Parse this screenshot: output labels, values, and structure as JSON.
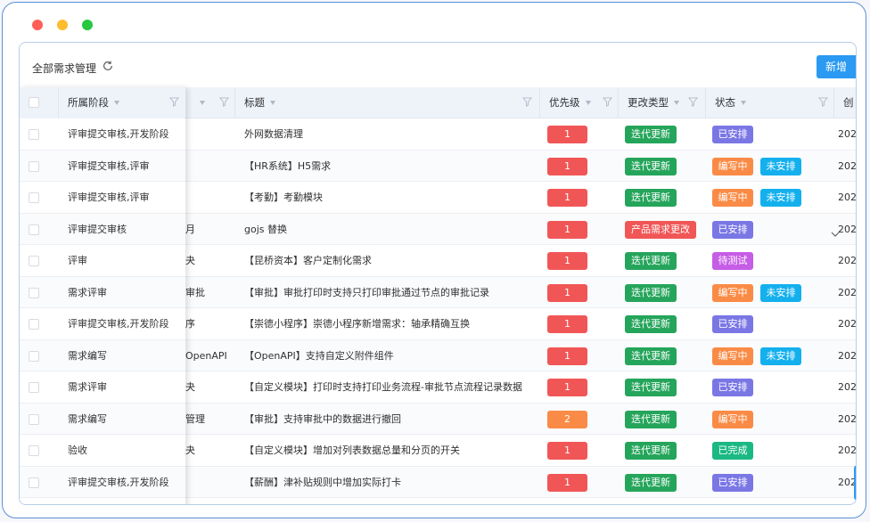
{
  "window_controls": {
    "close_color": "#ff5f57",
    "minimize_color": "#febc2e",
    "maximize_color": "#28c840"
  },
  "header": {
    "title": "全部需求管理",
    "refresh_icon": "refresh-icon",
    "new_button": "新增"
  },
  "columns": {
    "stage": "所属阶段",
    "module": "",
    "title": "标题",
    "priority": "优先级",
    "change_type": "更改类型",
    "status": "状态",
    "created": "创"
  },
  "colors": {
    "red": "#f15656",
    "orange": "#fa8b46",
    "green": "#25a55b",
    "red_tag": "#f15656",
    "purple": "#7a77e5",
    "cyan": "#14b0ee",
    "pink": "#c65de6",
    "teal": "#1bb884"
  },
  "rows": [
    {
      "stage": "评审提交审核,开发阶段",
      "module": "",
      "title": "外网数据清理",
      "priority": "1",
      "priority_color": "#f15656",
      "change": "迭代更新",
      "change_color": "#25a55b",
      "status": [
        {
          "label": "已安排",
          "color": "#7a77e5"
        }
      ],
      "created": "202"
    },
    {
      "stage": "评审提交审核,评审",
      "module": "",
      "title": "【HR系统】H5需求",
      "priority": "1",
      "priority_color": "#f15656",
      "change": "迭代更新",
      "change_color": "#25a55b",
      "status": [
        {
          "label": "编写中",
          "color": "#fa8b46"
        },
        {
          "label": "未安排",
          "color": "#14b0ee"
        }
      ],
      "created": "202"
    },
    {
      "stage": "评审提交审核,评审",
      "module": "",
      "title": "【考勤】考勤模块",
      "priority": "1",
      "priority_color": "#f15656",
      "change": "迭代更新",
      "change_color": "#25a55b",
      "status": [
        {
          "label": "编写中",
          "color": "#fa8b46"
        },
        {
          "label": "未安排",
          "color": "#14b0ee"
        }
      ],
      "created": "202"
    },
    {
      "stage": "评审提交审核",
      "module": "月",
      "title": "gojs 替换",
      "priority": "1",
      "priority_color": "#f15656",
      "change": "产品需求更改",
      "change_color": "#f15656",
      "status": [
        {
          "label": "已安排",
          "color": "#7a77e5"
        }
      ],
      "created": "202"
    },
    {
      "stage": "评审",
      "module": "夬",
      "title": "【昆桥资本】客户定制化需求",
      "priority": "1",
      "priority_color": "#f15656",
      "change": "迭代更新",
      "change_color": "#25a55b",
      "status": [
        {
          "label": "待测试",
          "color": "#c65de6"
        }
      ],
      "created": "202"
    },
    {
      "stage": "需求评审",
      "module": "审批",
      "title": "【审批】审批打印时支持只打印审批通过节点的审批记录",
      "priority": "1",
      "priority_color": "#f15656",
      "change": "迭代更新",
      "change_color": "#25a55b",
      "status": [
        {
          "label": "编写中",
          "color": "#fa8b46"
        },
        {
          "label": "未安排",
          "color": "#14b0ee"
        }
      ],
      "created": "202"
    },
    {
      "stage": "评审提交审核,开发阶段",
      "module": "序",
      "title": "【崇德小程序】崇德小程序新增需求：轴承精确互换",
      "priority": "1",
      "priority_color": "#f15656",
      "change": "迭代更新",
      "change_color": "#25a55b",
      "status": [
        {
          "label": "已安排",
          "color": "#7a77e5"
        }
      ],
      "created": "202"
    },
    {
      "stage": "需求编写",
      "module": "OpenAPI",
      "title": "【OpenAPI】支持自定义附件组件",
      "priority": "1",
      "priority_color": "#f15656",
      "change": "迭代更新",
      "change_color": "#25a55b",
      "status": [
        {
          "label": "编写中",
          "color": "#fa8b46"
        },
        {
          "label": "未安排",
          "color": "#14b0ee"
        }
      ],
      "created": "202"
    },
    {
      "stage": "需求评审",
      "module": "夬",
      "title": "【自定义模块】打印时支持打印业务流程-审批节点流程记录数据",
      "priority": "1",
      "priority_color": "#f15656",
      "change": "迭代更新",
      "change_color": "#25a55b",
      "status": [
        {
          "label": "已安排",
          "color": "#7a77e5"
        }
      ],
      "created": "202"
    },
    {
      "stage": "需求编写",
      "module": "管理",
      "title": "【审批】支持审批中的数据进行撤回",
      "priority": "2",
      "priority_color": "#fa8b46",
      "change": "迭代更新",
      "change_color": "#25a55b",
      "status": [
        {
          "label": "编写中",
          "color": "#fa8b46"
        }
      ],
      "created": "202"
    },
    {
      "stage": "验收",
      "module": "夬",
      "title": "【自定义模块】增加对列表数据总量和分页的开关",
      "priority": "1",
      "priority_color": "#f15656",
      "change": "迭代更新",
      "change_color": "#25a55b",
      "status": [
        {
          "label": "已完成",
          "color": "#1bb884"
        }
      ],
      "created": "202"
    },
    {
      "stage": "评审提交审核,开发阶段",
      "module": "",
      "title": "【薪酬】津补贴规则中增加实际打卡",
      "priority": "1",
      "priority_color": "#f15656",
      "change": "迭代更新",
      "change_color": "#25a55b",
      "status": [
        {
          "label": "已安排",
          "color": "#7a77e5"
        }
      ],
      "created": "202"
    }
  ]
}
